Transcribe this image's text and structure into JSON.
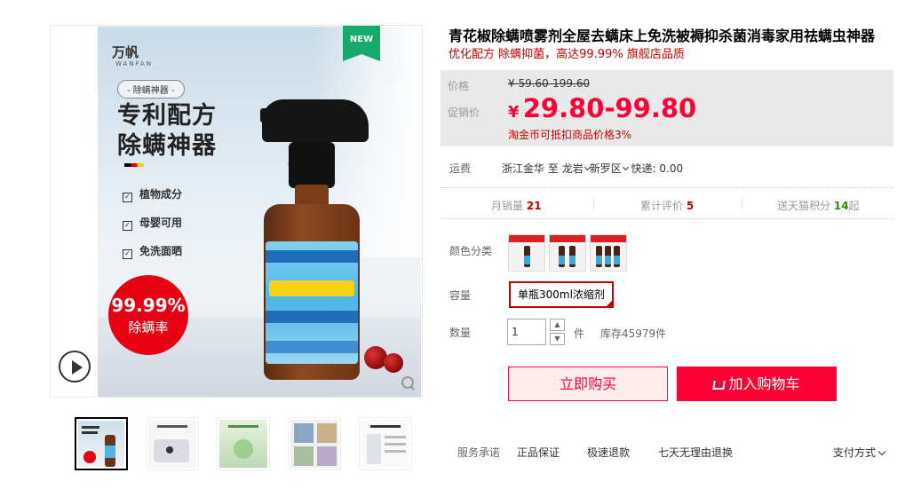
{
  "gallery": {
    "badge_new": "NEW",
    "brand_cn": "万帆",
    "brand_en": "WANFAN",
    "pill": "- 除螨神器 -",
    "headline_1": "专利配方",
    "headline_2": "除螨神器",
    "features": [
      "植物成分",
      "母婴可用",
      "免洗面晒"
    ],
    "badge_pct": "99.99%",
    "badge_label": "除螨率",
    "play_icon": "play-icon",
    "zoom_icon": "zoom-icon"
  },
  "product": {
    "title": "青花椒除螨喷雾剂全屋去螨床上免洗被褥抑杀菌消毒家用祛螨虫神器",
    "subtitle": "优化配方 除螨抑菌，高达99.99% 旗舰店品质"
  },
  "price": {
    "price_label": "价格",
    "old_price": "¥ 59.60-199.60",
    "promo_label": "促销价",
    "currency": "¥",
    "promo_price": "29.80-99.80",
    "coin_note": "淘金币可抵扣商品价格3%"
  },
  "shipping": {
    "label": "运费",
    "from": "浙江金华",
    "to_word": "至",
    "city": "龙岩",
    "district": "新罗区",
    "fee": "快递: 0.00"
  },
  "stats": [
    {
      "label": "月销量",
      "value": "21"
    },
    {
      "label": "累计评价",
      "value": "5"
    },
    {
      "label": "送天猫积分",
      "value": "14",
      "suffix": "起"
    }
  ],
  "sku": {
    "color_label": "颜色分类",
    "capacity_label": "容量",
    "capacity_option": "单瓶300ml浓缩剂",
    "qty_label": "数量",
    "qty_value": "1",
    "qty_unit": "件",
    "stock": "库存45979件"
  },
  "actions": {
    "buy_now": "立即购买",
    "add_cart": "加入购物车"
  },
  "service": {
    "label": "服务承诺",
    "items": [
      "正品保证",
      "极速退款",
      "七天无理由退换"
    ],
    "payment": "支付方式"
  },
  "colors": {
    "accent": "#ff0036",
    "dark_red": "#c40000",
    "new_green": "#17a86c"
  }
}
